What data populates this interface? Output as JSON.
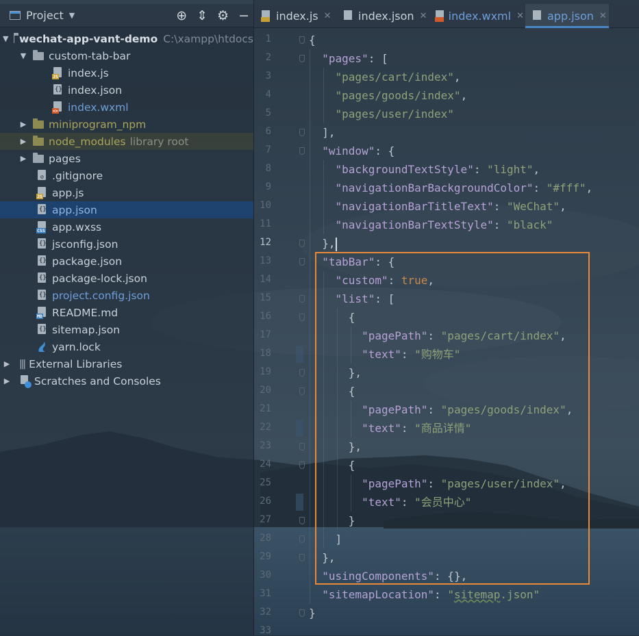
{
  "panel": {
    "title": "Project",
    "tools": [
      "locate-icon",
      "collapse-icon",
      "gear-icon",
      "hide-icon"
    ]
  },
  "tree": {
    "root": {
      "name": "wechat-app-vant-demo",
      "path": "C:\\xampp\\htdocs"
    },
    "folder_custom": "custom-tab-bar",
    "custom_files": [
      "index.js",
      "index.json",
      "index.wxml"
    ],
    "miniprogram_npm": "miniprogram_npm",
    "node_modules": "node_modules",
    "node_modules_note": "library root",
    "pages": "pages",
    "files": [
      ".gitignore",
      "app.js",
      "app.json",
      "app.wxss",
      "jsconfig.json",
      "package.json",
      "package-lock.json",
      "project.config.json",
      "README.md",
      "sitemap.json",
      "yarn.lock"
    ],
    "external": "External Libraries",
    "scratches": "Scratches and Consoles"
  },
  "tabs": [
    {
      "label": "index.js",
      "active": false
    },
    {
      "label": "index.json",
      "active": false
    },
    {
      "label": "index.wxml",
      "active": false
    },
    {
      "label": "app.json",
      "active": true
    }
  ],
  "editor": {
    "current_line": 12,
    "line_numbers": [
      "1",
      "2",
      "3",
      "4",
      "5",
      "6",
      "7",
      "8",
      "9",
      "10",
      "11",
      "12",
      "13",
      "14",
      "15",
      "16",
      "17",
      "18",
      "19",
      "20",
      "21",
      "22",
      "23",
      "24",
      "25",
      "26",
      "27",
      "28",
      "29",
      "30",
      "31",
      "32",
      "33"
    ],
    "lines": [
      "{",
      "  \"pages\": [",
      "    \"pages/cart/index\",",
      "    \"pages/goods/index\",",
      "    \"pages/user/index\"",
      "  ],",
      "  \"window\": {",
      "    \"backgroundTextStyle\": \"light\",",
      "    \"navigationBarBackgroundColor\": \"#fff\",",
      "    \"navigationBarTitleText\": \"WeChat\",",
      "    \"navigationBarTextStyle\": \"black\"",
      "  },",
      "  \"tabBar\": {",
      "    \"custom\": true,",
      "    \"list\": [",
      "      {",
      "        \"pagePath\": \"pages/cart/index\",",
      "        \"text\": \"购物车\"",
      "      },",
      "      {",
      "        \"pagePath\": \"pages/goods/index\",",
      "        \"text\": \"商品详情\"",
      "      },",
      "      {",
      "        \"pagePath\": \"pages/user/index\",",
      "        \"text\": \"会员中心\"",
      "      }",
      "    ]",
      "  },",
      "  \"usingComponents\": {},",
      "  \"sitemapLocation\": \"sitemap.json\"",
      "}",
      ""
    ]
  },
  "colors": {
    "accent": "#4a88c7",
    "highlight_box": "#e98a3a",
    "selection": "#1b4474",
    "json_key": "#b6a3d6",
    "json_string": "#8fa27a",
    "json_keyword": "#c98a4a"
  }
}
